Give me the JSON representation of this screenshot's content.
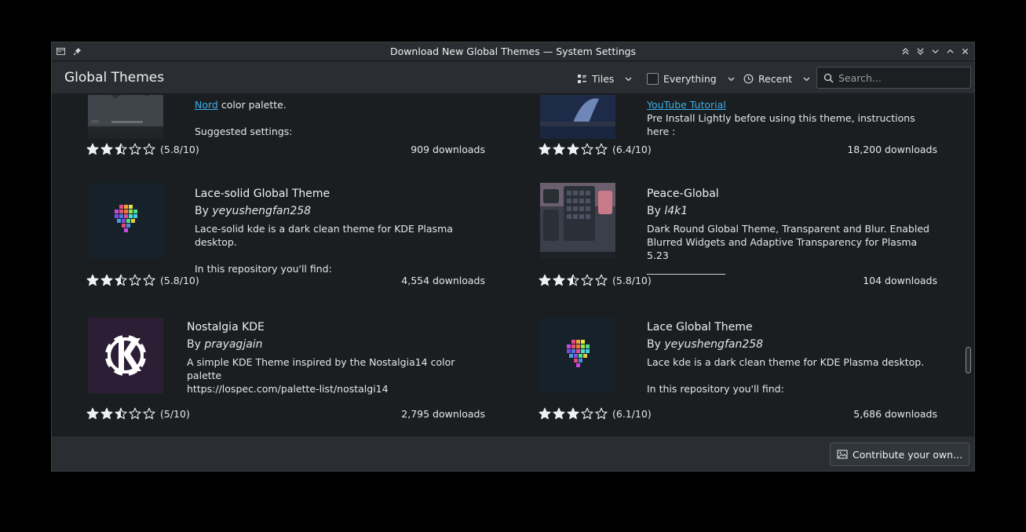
{
  "window": {
    "title": "Download New Global Themes — System Settings"
  },
  "toolbar": {
    "page_title": "Global Themes",
    "view_label": "Tiles",
    "filter_label": "Everything",
    "sort_label": "Recent",
    "search_placeholder": "Search..."
  },
  "cards": [
    {
      "id": "partial-left",
      "title": "",
      "author": "",
      "desc_link": "Nord",
      "desc_rest": " color palette.",
      "desc_extra": "Suggested settings:",
      "rating_text": "(5.8/10)",
      "rating_stars": 2.5,
      "downloads": "909 downloads"
    },
    {
      "id": "partial-right",
      "title": "",
      "author": "",
      "desc_link": "YouTube Tutorial",
      "desc_rest": "",
      "desc_extra": "Pre Install Lightly before using this theme, instructions here :",
      "rating_text": "(6.4/10)",
      "rating_stars": 3,
      "downloads": "18,200 downloads"
    },
    {
      "id": "lace-solid",
      "title": "Lace-solid Global Theme",
      "by": "By ",
      "author": "yeyushengfan258",
      "desc": "Lace-solid kde is a dark clean theme for KDE Plasma\ndesktop.\n\nIn this repository you'll find:",
      "rating_text": "(5.8/10)",
      "rating_stars": 2.5,
      "downloads": "4,554 downloads"
    },
    {
      "id": "peace-global",
      "title": "Peace-Global",
      "by": "By ",
      "author": "l4k1",
      "desc": "Dark Round Global Theme, Transparent and Blur. Enabled\nBlurred Widgets and Adaptive Transparency for Plasma 5.23\n________________",
      "rating_text": "(5.8/10)",
      "rating_stars": 2.5,
      "downloads": "104 downloads"
    },
    {
      "id": "nostalgia",
      "title": "Nostalgia KDE",
      "by": "By ",
      "author": "prayagjain",
      "desc": "A simple KDE Theme inspired by the Nostalgia14 color palette\nhttps://lospec.com/palette-list/nostalgi14",
      "rating_text": "(5/10)",
      "rating_stars": 2.5,
      "downloads": "2,795 downloads"
    },
    {
      "id": "lace-global",
      "title": "Lace Global Theme",
      "by": "By ",
      "author": "yeyushengfan258",
      "desc": "Lace kde is a dark clean theme for KDE Plasma desktop.\n\nIn this repository you'll find:",
      "rating_text": "(6.1/10)",
      "rating_stars": 3,
      "downloads": "5,686 downloads"
    }
  ],
  "footer": {
    "contribute_label": "Contribute your own..."
  },
  "colors": {
    "accent": "#3daee9",
    "background": "#1b1e20",
    "chrome": "#2a2e32"
  }
}
